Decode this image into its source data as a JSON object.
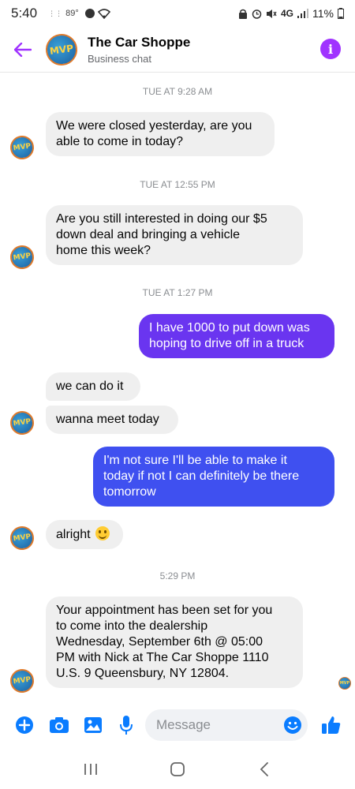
{
  "status_bar": {
    "time": "5:40",
    "temperature": "89°",
    "network": "4G",
    "battery": "11%"
  },
  "header": {
    "title": "The Car Shoppe",
    "subtitle": "Business chat",
    "avatar_text": "MVP",
    "accent_color": "#a033ff"
  },
  "conversation": {
    "timestamps": [
      "TUE AT 9:28 AM",
      "TUE AT 12:55 PM",
      "TUE AT 1:27 PM",
      "5:29 PM"
    ],
    "messages": [
      {
        "from": "business",
        "lines": [
          "We were closed yesterday, are you",
          "able to come in today?"
        ]
      },
      {
        "from": "business",
        "lines": [
          "Are you still interested in doing our $5",
          "down deal and bringing a vehicle",
          "home this week?"
        ]
      },
      {
        "from": "me",
        "lines": [
          "I have 1000 to put down was",
          "hoping to drive off in a truck"
        ]
      },
      {
        "from": "business",
        "lines": [
          "we can do it"
        ]
      },
      {
        "from": "business",
        "lines": [
          "wanna meet today"
        ]
      },
      {
        "from": "me",
        "lines": [
          "I'm not sure I'll be able to make it",
          "today if not I can definitely be there",
          "tomorrow"
        ]
      },
      {
        "from": "business",
        "lines": [
          "alright"
        ]
      },
      {
        "from": "business",
        "lines": [
          "Your appointment has been set for you",
          "to come into the dealership",
          "Wednesday, September 6th @ 05:00",
          "PM  with Nick at The Car Shoppe 1110",
          "U.S. 9 Queensbury, NY 12804."
        ]
      }
    ],
    "avatar_text": "MVP"
  },
  "composer": {
    "placeholder": "Message",
    "accent_color": "#0a7cff"
  },
  "colors": {
    "bubble_in": "#efefef",
    "bubble_out_top": "#7b2ff7",
    "bubble_out_bottom": "#3b5bff"
  }
}
